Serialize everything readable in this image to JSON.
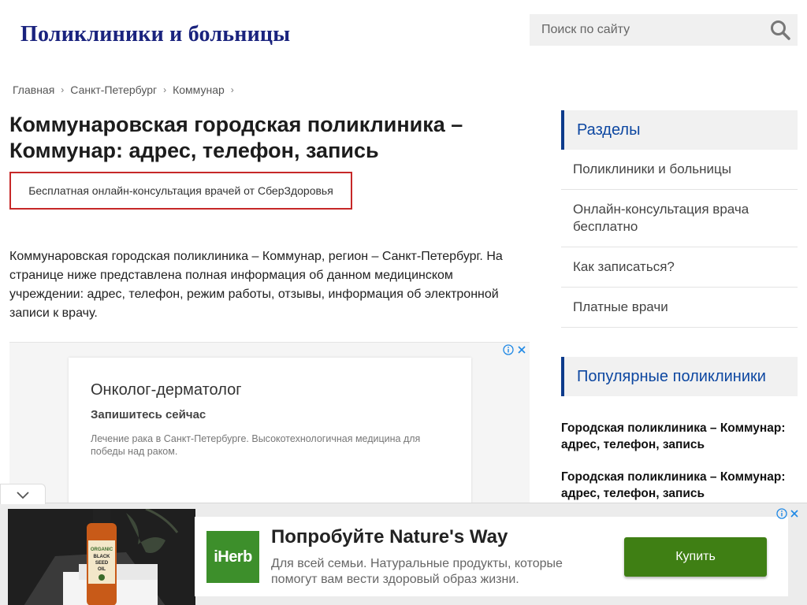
{
  "header": {
    "site_title": "Поликлиники и больницы",
    "search_placeholder": "Поиск по сайту"
  },
  "breadcrumb": {
    "items": [
      "Главная",
      "Санкт-Петербург",
      "Коммунар"
    ],
    "separator": "›"
  },
  "article": {
    "title": "Коммунаровская городская поликлиника – Коммунар: адрес, телефон, запись",
    "consult_link": "Бесплатная онлайн-консультация врачей от СберЗдоровья",
    "intro": "Коммунаровская городская поликлиника – Коммунар, регион – Санкт-Петербург. На странице ниже представлена полная информация об данном медицинском учреждении: адрес, телефон, режим работы, отзывы, информация об электронной записи к врачу."
  },
  "ad_inline": {
    "title": "Онколог-дерматолог",
    "subtitle": "Запишитесь сейчас",
    "description": "Лечение рака в Санкт-Петербурге. Высокотехнологичная медицина для победы над раком."
  },
  "sidebar": {
    "sections_title": "Разделы",
    "items": [
      "Поликлиники и больницы",
      "Онлайн-консультация врача бесплатно",
      "Как записаться?",
      "Платные врачи"
    ],
    "popular_title": "Популярные поликлиники",
    "popular_items": [
      "Городская поликлиника – Коммунар: адрес, телефон, запись",
      "Городская поликлиника – Коммунар: адрес, телефон, запись"
    ]
  },
  "bottom_ad": {
    "logo_text": "iHerb",
    "title": "Попробуйте Nature's Way",
    "description": "Для всей семьи. Натуральные продукты, которые помогут вам вести здоровый образ жизни.",
    "button_label": "Купить",
    "product_label": "ORGANIC BLACK SEED OIL"
  },
  "colors": {
    "site_title": "#1a237e",
    "section_accent": "#0d3b8c",
    "consult_border": "#c62828",
    "buy_button": "#3f7f14",
    "iherb_green": "#3d8f2b"
  },
  "icons": [
    "search-icon",
    "info-icon",
    "close-icon",
    "chevron-down-icon"
  ]
}
